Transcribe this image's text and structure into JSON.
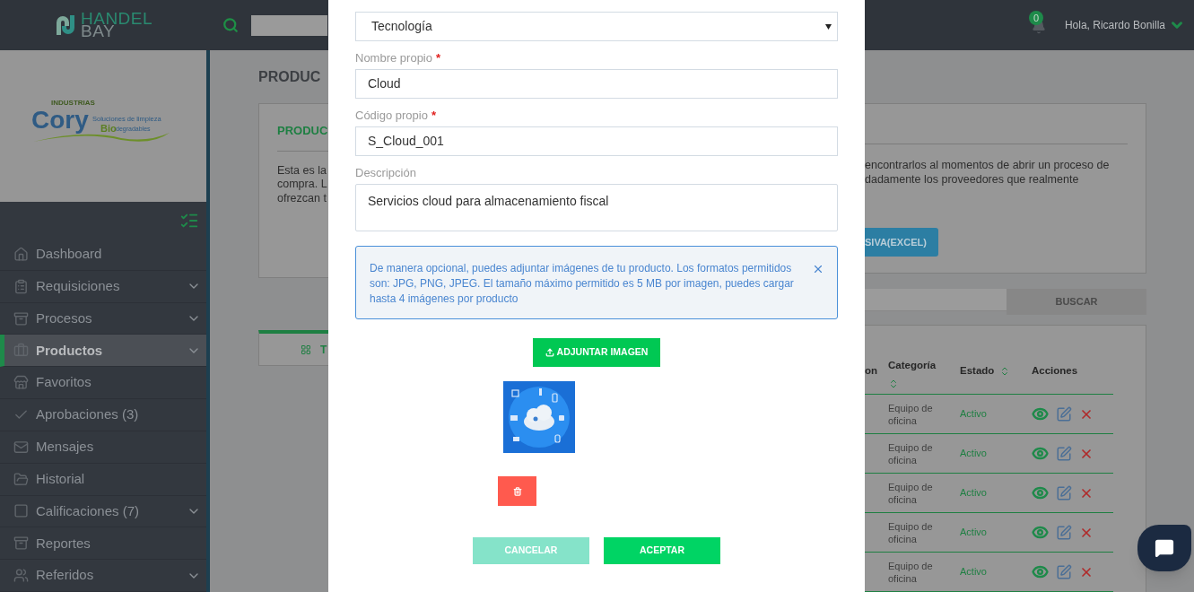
{
  "header": {
    "logo_top": "HANDEL",
    "logo_bottom": "BAY",
    "notification_count": "0",
    "greeting": "Hola, Ricardo Bonilla"
  },
  "company_logo": {
    "small": "INDUSTRIAS",
    "name": "Cory",
    "tagline": "Soluciones de limpieza",
    "bio": "Bio",
    "tagline_2": "degradables"
  },
  "sidebar": {
    "items": [
      {
        "label": "Dashboard",
        "expandable": false,
        "selected": false
      },
      {
        "label": "Requisiciones",
        "expandable": true,
        "selected": false
      },
      {
        "label": "Procesos",
        "expandable": true,
        "selected": false
      },
      {
        "label": "Productos",
        "expandable": true,
        "selected": true
      },
      {
        "label": "Favoritos",
        "expandable": false,
        "selected": false
      },
      {
        "label": "Aprobaciones (3)",
        "expandable": false,
        "selected": false
      },
      {
        "label": "Mensajes",
        "expandable": false,
        "selected": false
      },
      {
        "label": "Historial",
        "expandable": false,
        "selected": false
      },
      {
        "label": "Calificaciones (7)",
        "expandable": true,
        "selected": false
      },
      {
        "label": "Reportes",
        "expandable": false,
        "selected": false
      },
      {
        "label": "Referidos",
        "expandable": true,
        "selected": false
      }
    ]
  },
  "page": {
    "title": "PRODUC",
    "card_title": "PRODUC",
    "intro_left": [
      "Esta es la",
      "compra. L",
      "ofrezcan t"
    ],
    "intro_right": [
      "encontrarlos al momentos de abrir un proceso de",
      "dadamente los proveedores que realmente"
    ],
    "excel_button": "SIVA(EXCEL)",
    "search_button": "BUSCAR",
    "tab": "T",
    "table": {
      "columns": [
        {
          "label": "on",
          "sortable": false
        },
        {
          "label": "Categoría",
          "sortable": true
        },
        {
          "label": "Estado",
          "sortable": true
        },
        {
          "label": "Acciones",
          "sortable": false
        }
      ],
      "rows": [
        {
          "category": "Equipo de oficina",
          "status": "Activo"
        },
        {
          "category": "Equipo de oficina",
          "status": "Activo"
        },
        {
          "category": "Equipo de oficina",
          "status": "Activo"
        },
        {
          "category": "Equipo de oficina",
          "status": "Activo"
        },
        {
          "category": "Equipo de oficina",
          "status": "Activo"
        }
      ]
    }
  },
  "modal": {
    "fields": [
      {
        "kind": "select",
        "value": "Tecnología"
      },
      {
        "kind": "input",
        "label": "Nombre propio",
        "required_mark": "*",
        "value": "Cloud"
      },
      {
        "kind": "input",
        "label": "Código propio",
        "required_mark": "*",
        "value": "S_Cloud_001"
      },
      {
        "kind": "textarea",
        "label": "Descripción",
        "value": "Servicios cloud para almacenamiento fiscal"
      }
    ],
    "alert": "De manera opcional, puedes adjuntar imágenes de tu producto. Los formatos permitidos son: JPG, PNG, JPEG. El tamaño máximo permitido es 5 MB por imagen, puedes cargar hasta 4 imágenes por producto",
    "attach_button": "ADJUNTAR IMAGEN",
    "buttons": [
      {
        "label": "CANCELAR",
        "kind": "secondary"
      },
      {
        "label": "ACEPTAR",
        "kind": "primary"
      }
    ]
  }
}
